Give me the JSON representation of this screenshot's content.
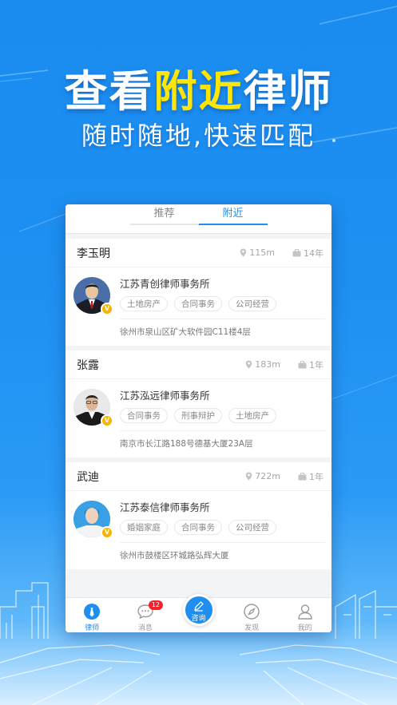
{
  "banner": {
    "headline_pre": "查看",
    "headline_highlight": "附近",
    "headline_post": "律师",
    "subline": "随时随地,快速匹配"
  },
  "tabs": [
    {
      "label": "推荐",
      "active": false
    },
    {
      "label": "附近",
      "active": true
    }
  ],
  "lawyers": [
    {
      "name": "李玉明",
      "distance": "115m",
      "years": "14年",
      "firm": "江苏青创律师事务所",
      "tags": [
        "土地房产",
        "合同事务",
        "公司经营"
      ],
      "address": "徐州市泉山区矿大软件园C11楼4层"
    },
    {
      "name": "张露",
      "distance": "183m",
      "years": "1年",
      "firm": "江苏泓远律师事务所",
      "tags": [
        "合同事务",
        "刑事辩护",
        "土地房产"
      ],
      "address": "南京市长江路188号德基大厦23A层"
    },
    {
      "name": "武迪",
      "distance": "722m",
      "years": "1年",
      "firm": "江苏泰信律师事务所",
      "tags": [
        "婚姻家庭",
        "合同事务",
        "公司经营"
      ],
      "address": "徐州市鼓楼区环城路弘辉大厦"
    }
  ],
  "tabbar": {
    "lawyer": "律师",
    "messages": "消息",
    "messages_badge": "12",
    "consult": "咨询",
    "discover": "发现",
    "mine": "我的"
  },
  "colors": {
    "accent": "#1e8ff0",
    "highlight": "#ffe600",
    "badge": "#f5222d",
    "verified": "#f7b500"
  },
  "icons": [
    "location-pin-icon",
    "briefcase-icon",
    "verified-v-icon",
    "lawyer-tie-icon",
    "message-icon",
    "pen-icon",
    "compass-icon",
    "user-icon"
  ]
}
